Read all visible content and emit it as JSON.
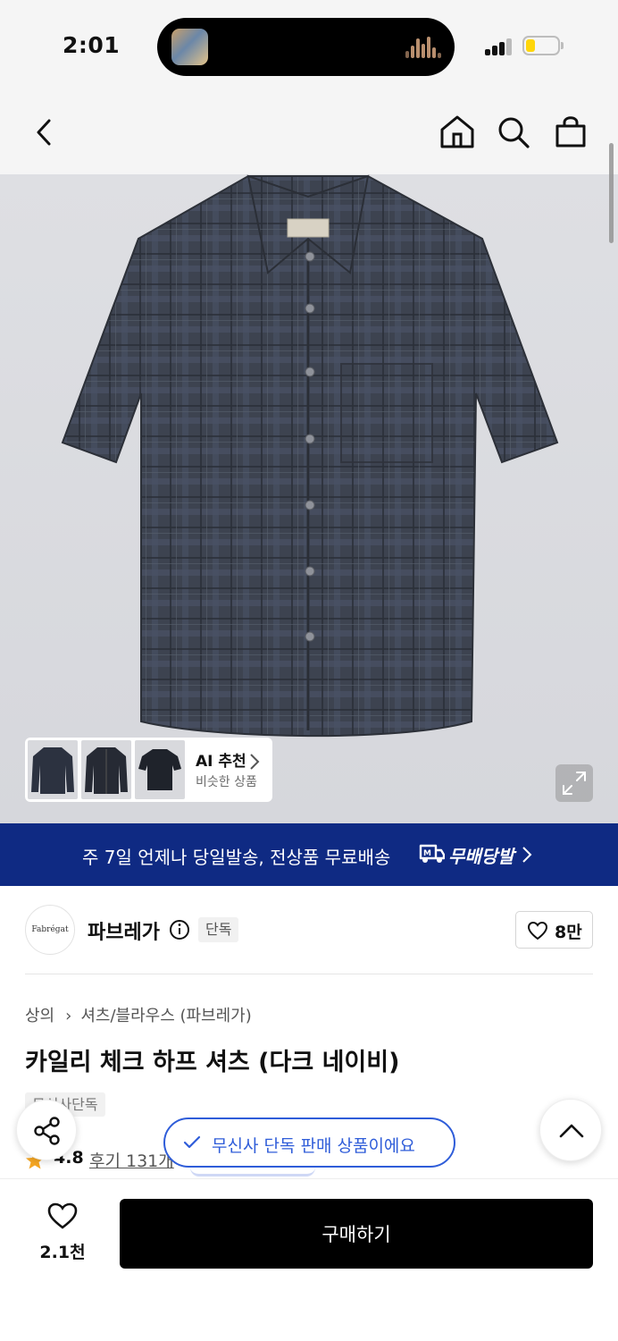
{
  "status_bar": {
    "time": "2:01",
    "battery_level": 0.2,
    "battery_color": "#ffd60a"
  },
  "nav": {
    "icons": [
      "back-icon",
      "home-icon",
      "search-icon",
      "cart-icon"
    ]
  },
  "gallery": {
    "ai_title": "AI 추천",
    "ai_subtitle": "비슷한 상품"
  },
  "banner": {
    "text": "주 7일 언제나 당일발송, 전상품 무료배송",
    "tag": "무배당발",
    "background": "#0f2a83"
  },
  "brand": {
    "logo_text": "Fabrégat",
    "name": "파브레가",
    "exclusive_chip": "단독",
    "like_count": "8만"
  },
  "product": {
    "breadcrumb": [
      "상의",
      "셔츠/블라우스 (파브레가)"
    ],
    "title": "카일리 체크 하프 셔츠 (다크 네이비)",
    "tag": "무신사단독",
    "rating": "4.8",
    "reviews": "후기 131개"
  },
  "toast": {
    "text": "무신사 단독 판매 상품이에요",
    "color": "#2f5dd9"
  },
  "bottom_bar": {
    "wish_count": "2.1천",
    "buy_label": "구매하기"
  }
}
